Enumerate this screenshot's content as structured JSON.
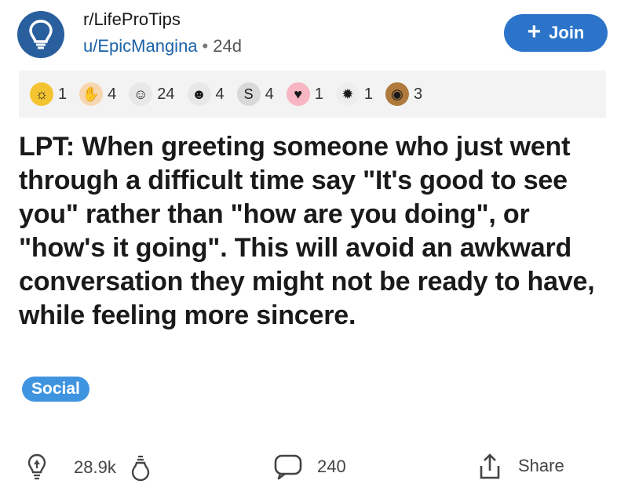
{
  "header": {
    "subreddit": "r/LifeProTips",
    "user": "u/EpicMangina",
    "separator": "•",
    "age": "24d",
    "join_label": "Join",
    "join_icon": "plus-icon"
  },
  "awards": [
    {
      "icon": "sun-award-icon",
      "count": "1",
      "color": "#f4c430",
      "glyph": "☼"
    },
    {
      "icon": "helpful-hand-award-icon",
      "count": "4",
      "color": "#f6d7b0",
      "glyph": "✋"
    },
    {
      "icon": "wholesome-hug-award-icon",
      "count": "24",
      "color": "#e8e8e8",
      "glyph": "☺"
    },
    {
      "icon": "face-award-icon",
      "count": "4",
      "color": "#e8e8e8",
      "glyph": "☻"
    },
    {
      "icon": "silver-award-icon",
      "count": "4",
      "color": "#d9d9d9",
      "glyph": "S"
    },
    {
      "icon": "heart-award-icon",
      "count": "1",
      "color": "#f7b6c2",
      "glyph": "♥"
    },
    {
      "icon": "starstruck-award-icon",
      "count": "1",
      "color": "#eeeeee",
      "glyph": "✹"
    },
    {
      "icon": "bear-award-icon",
      "count": "3",
      "color": "#b07a3c",
      "glyph": "◉"
    }
  ],
  "post": {
    "title": "LPT: When greeting someone who just went through a difficult time say \"It's good to see you\" rather than \"how are you doing\", or \"how's it going\". This will avoid an awkward conversation they might not be ready to have, while feeling more sincere.",
    "flair": "Social"
  },
  "footer": {
    "upvotes": "28.9k",
    "comments": "240",
    "share_label": "Share"
  },
  "colors": {
    "accent": "#2b74c9",
    "flair": "#3f94e0",
    "avatar": "#2a5f9e"
  }
}
